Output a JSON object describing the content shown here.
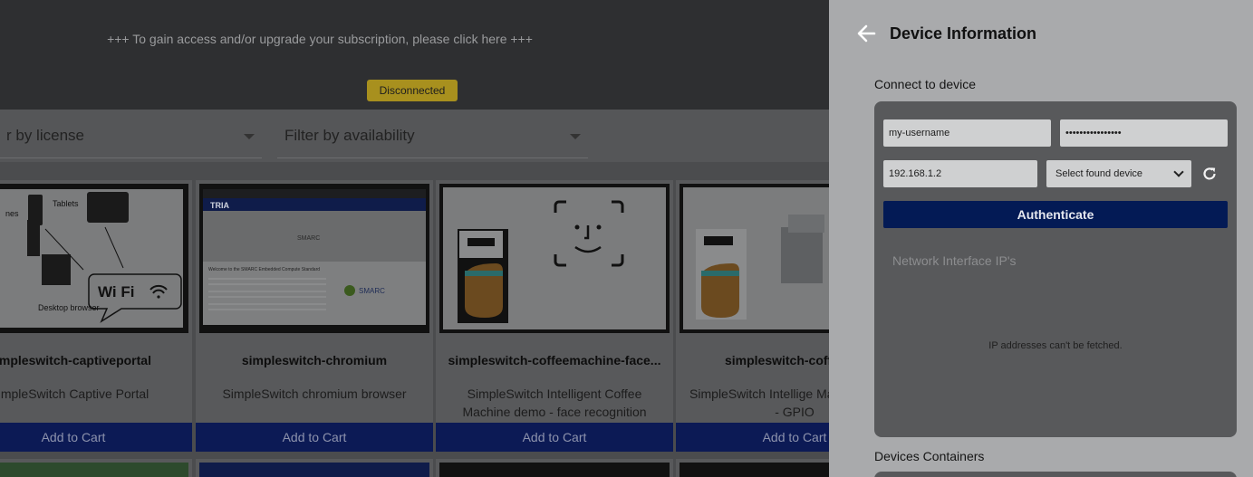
{
  "banner": {
    "message": "+++ To gain access and/or upgrade your subscription, please click here +++",
    "status": "Disconnected"
  },
  "filters": [
    {
      "label": "r by license"
    },
    {
      "label": "Filter by availability"
    }
  ],
  "cards": [
    {
      "title": "impleswitch-captiveportal",
      "description": "impleSwitch Captive Portal",
      "cart": "Add to Cart"
    },
    {
      "title": "simpleswitch-chromium",
      "description": "SimpleSwitch chromium browser",
      "cart": "Add to Cart"
    },
    {
      "title": "simpleswitch-coffeemachine-face...",
      "description": "SimpleSwitch Intelligent Coffee Machine demo - face recognition",
      "cart": "Add to Cart"
    },
    {
      "title": "simpleswitch-coffeema",
      "description": "SimpleSwitch Intellige Machine demo - GPIO",
      "cart": "Add to Cart"
    }
  ],
  "thumb_text": {
    "captive": {
      "tablets": "Tablets",
      "phones": "nes",
      "desktop": "Desktop browser",
      "wifi": "Wi Fi"
    },
    "chromium": {
      "brand": "TRIA",
      "heading": "Welcome to the SMARC Embedded Compute Standard",
      "logo": "SMARC"
    }
  },
  "panel": {
    "title": "Device Information",
    "connect_label": "Connect to device",
    "username": "my-username",
    "password": "••••••••••••••••",
    "ip": "192.168.1.2",
    "select_placeholder": "Select found device",
    "authenticate": "Authenticate",
    "network_label": "Network Interface IP's",
    "network_empty": "IP addresses can't be fetched.",
    "containers_label": "Devices Containers"
  },
  "colors": {
    "accent": "#031a55",
    "badge": "#a8901e"
  }
}
